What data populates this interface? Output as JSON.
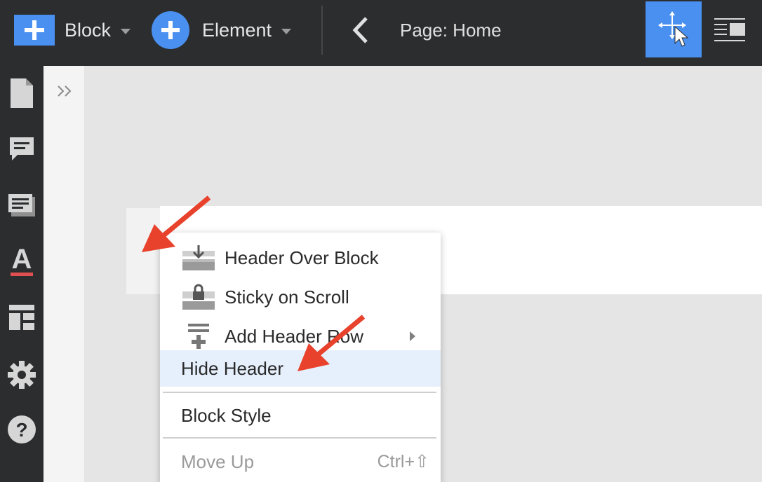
{
  "toolbar": {
    "block_label": "Block",
    "element_label": "Element",
    "page_label": "Page: Home"
  },
  "context_menu": {
    "items": [
      {
        "label": "Header Over Block",
        "icon": "header-over-block-icon"
      },
      {
        "label": "Sticky on Scroll",
        "icon": "lock-header-icon"
      },
      {
        "label": "Add Header Row",
        "icon": "add-row-icon",
        "submenu": true
      },
      {
        "label": "Hide Header",
        "highlighted": true
      },
      {
        "label": "Block Style"
      },
      {
        "label": "Move Up",
        "shortcut": "Ctrl+⇧",
        "disabled": true
      }
    ]
  },
  "colors": {
    "accent": "#4a90f0",
    "dark_bg": "#2b2d2f",
    "highlight": "#e6f0fc",
    "annotation": "#e8412c"
  }
}
